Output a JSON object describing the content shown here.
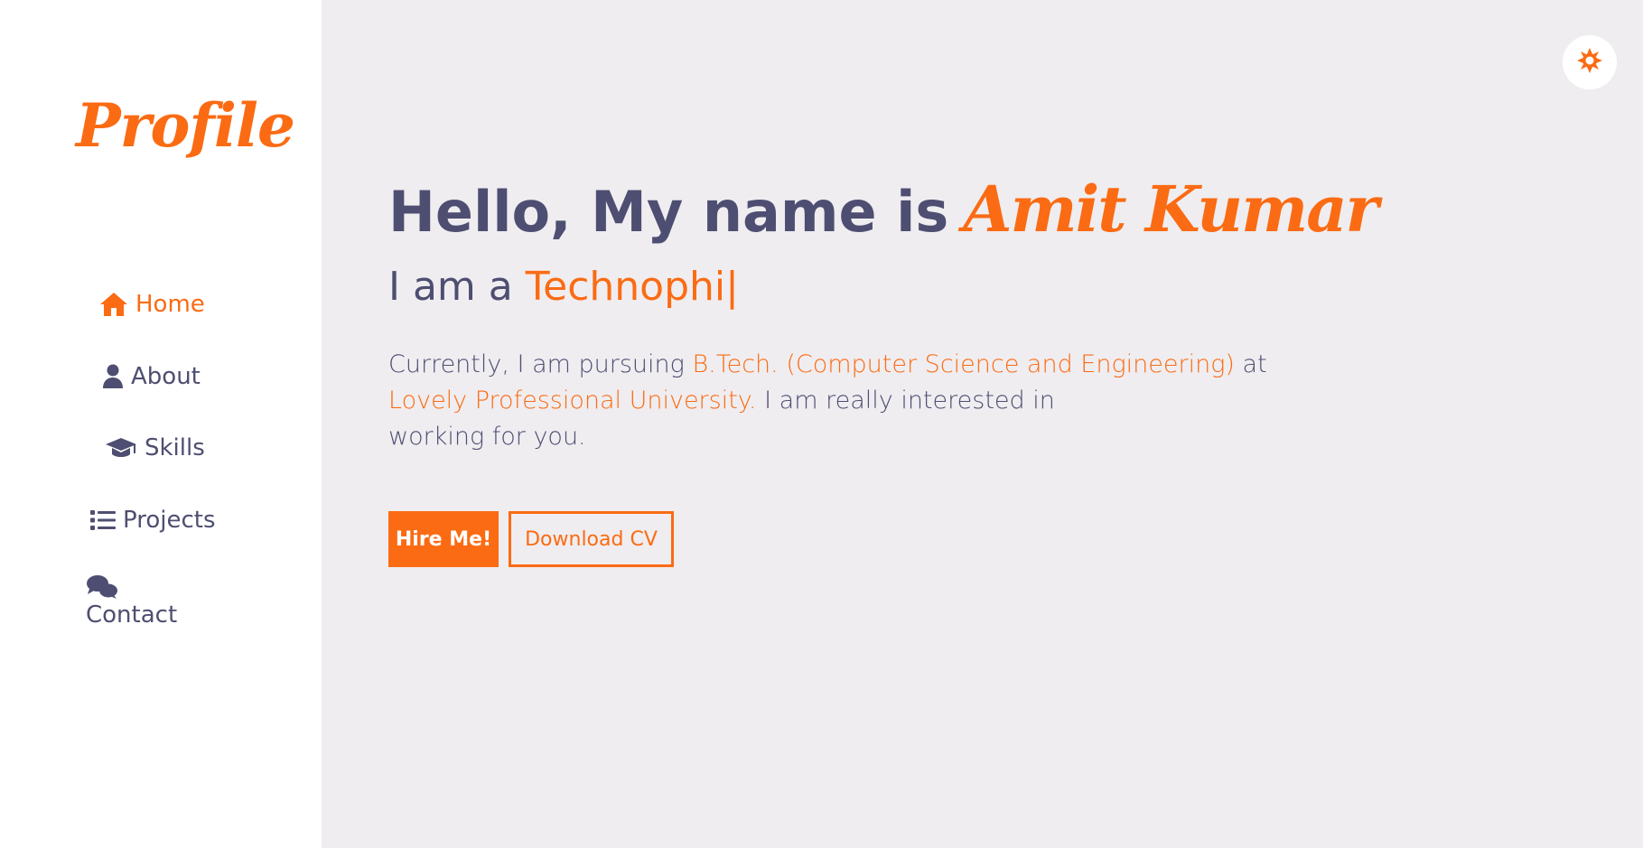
{
  "colors": {
    "accent": "#fb6b13",
    "text": "#4e4e72",
    "background": "#efedf0",
    "sidebar": "#ffffff"
  },
  "sidebar": {
    "logo": "Profile",
    "nav": [
      {
        "label": "Home",
        "icon": "home-icon",
        "active": true
      },
      {
        "label": "About",
        "icon": "user-icon",
        "active": false
      },
      {
        "label": "Skills",
        "icon": "graduation-cap-icon",
        "active": false
      },
      {
        "label": "Projects",
        "icon": "list-icon",
        "active": false
      },
      {
        "label": "Contact",
        "icon": "comments-icon",
        "active": false
      }
    ]
  },
  "theme_toggle": {
    "icon": "sun-icon"
  },
  "hero": {
    "greeting_prefix": "Hello, My name is",
    "name": "Amit Kumar",
    "role_prefix": "I am a",
    "role_typed": "Technophi|",
    "description": {
      "part1": "Currently, I am pursuing ",
      "degree": "B.Tech. (Computer Science and Engineering)",
      "part2": " at",
      "university": "Lovely Professional University.",
      "part3": " I am really interested in",
      "part4": "working for you."
    },
    "buttons": {
      "hire": "Hire Me!",
      "cv": "Download CV"
    }
  }
}
